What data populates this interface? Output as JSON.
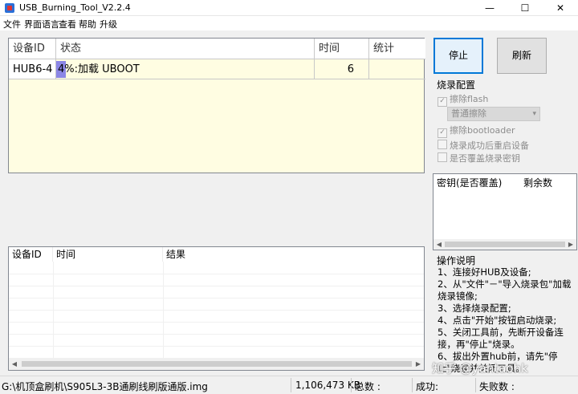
{
  "window": {
    "title": "USB_Burning_Tool_V2.2.4",
    "minimize": "—",
    "maximize": "☐",
    "close": "✕"
  },
  "menu": [
    "文件",
    "界面语言",
    "查看",
    "帮助",
    "升级"
  ],
  "device_table": {
    "columns": [
      "设备ID",
      "状态",
      "时间",
      "统计"
    ],
    "rows": [
      {
        "device_id": "HUB6-4",
        "status": "4%:加载 UBOOT",
        "progress_percent": 4,
        "time": "6",
        "stat": ""
      }
    ]
  },
  "log_table": {
    "columns": [
      "设备ID",
      "时间",
      "结果"
    ]
  },
  "buttons": {
    "stop": "停止",
    "refresh": "刷新"
  },
  "burn_config": {
    "title": "烧录配置",
    "erase_flash": "擦除flash",
    "erase_mode": "普通擦除",
    "erase_bootloader": "擦除bootloader",
    "reboot_after": "烧录成功后重启设备",
    "overwrite_key": "是否覆盖烧录密钥"
  },
  "key_table": {
    "columns": [
      "密钥(是否覆盖)",
      "剩余数"
    ]
  },
  "instructions": {
    "title": "操作说明",
    "lines": [
      "1、连接好HUB及设备;",
      "2、从\"文件\"－\"导入烧录包\"加载烧录镜像;",
      "3、选择烧录配置;",
      "4、点击\"开始\"按钮启动烧录;",
      "5、关闭工具前，先断开设备连接，再\"停止\"烧录。",
      "6、拔出外置hub前，请先\"停止\"烧录并关闭工具。"
    ]
  },
  "status_bar": {
    "path": "G:\\机顶盒刷机\\S905L3-3B通刷线刷版通版.img",
    "size": "1,106,473 KB",
    "total": "总数 :",
    "success": "成功:",
    "failed": "失败数 :"
  },
  "watermark": "知乎 @yantaohk"
}
